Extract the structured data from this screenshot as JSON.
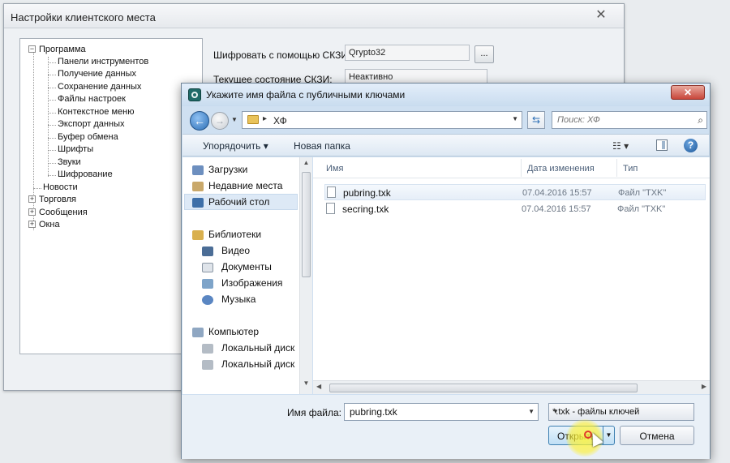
{
  "bg_window": {
    "title": "Настройки клиентского места",
    "close": "✕",
    "tree": {
      "root": "Программа",
      "children": [
        "Панели инструментов",
        "Получение данных",
        "Сохранение данных",
        "Файлы настроек",
        "Контекстное меню",
        "Экспорт данных",
        "Буфер обмена",
        "Шрифты",
        "Звуки",
        "Шифрование"
      ],
      "others": [
        "Новости",
        "Торговля",
        "Сообщения",
        "Окна"
      ]
    },
    "encrypt_label": "Шифровать с помощью СКЗИ:",
    "encrypt_value": "Qrypto32",
    "state_label": "Текущее состояние СКЗИ:",
    "state_value": "Неактивно",
    "dots": "..."
  },
  "dialog": {
    "title": "Укажите имя файла с публичными ключами",
    "close": "✕",
    "address": {
      "separator": "▸",
      "path": "ХФ"
    },
    "search_placeholder": "Поиск: ХФ",
    "toolbar": {
      "organize": "Упорядочить ▾",
      "new_folder": "Новая папка",
      "help": "?"
    },
    "nav": {
      "favorites": [
        "Загрузки",
        "Недавние места",
        "Рабочий стол"
      ],
      "libraries_title": "Библиотеки",
      "libraries": [
        "Видео",
        "Документы",
        "Изображения",
        "Музыка"
      ],
      "computer_title": "Компьютер",
      "computer": [
        "Локальный диск",
        "Локальный диск"
      ]
    },
    "columns": {
      "name": "Имя",
      "date": "Дата изменения",
      "type": "Тип"
    },
    "files": [
      {
        "name": "pubring.txk",
        "date": "07.04.2016 15:57",
        "type": "Файл \"TXK\""
      },
      {
        "name": "secring.txk",
        "date": "07.04.2016 15:57",
        "type": "Файл \"TXK\""
      }
    ],
    "filename_label": "Имя файла:",
    "filename_value": "pubring.txk",
    "filter": "*.txk - файлы ключей",
    "open_button": "Открыть",
    "cancel_button": "Отмена"
  }
}
